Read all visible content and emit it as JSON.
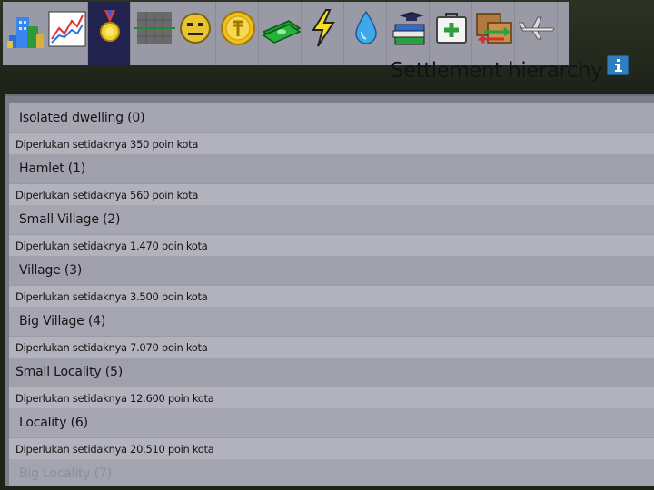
{
  "toolbar": {
    "tabs": [
      {
        "icon": "city-buildings-icon",
        "active": false
      },
      {
        "icon": "line-chart-icon",
        "active": false
      },
      {
        "icon": "medal-icon",
        "active": true
      },
      {
        "icon": "grid-map-icon",
        "active": false
      },
      {
        "icon": "smiley-face-icon",
        "active": false
      },
      {
        "icon": "gold-coin-icon",
        "active": false
      },
      {
        "icon": "money-bills-icon",
        "active": false
      },
      {
        "icon": "lightning-icon",
        "active": false
      },
      {
        "icon": "water-drop-icon",
        "active": false
      },
      {
        "icon": "books-education-icon",
        "active": false
      },
      {
        "icon": "first-aid-kit-icon",
        "active": false
      },
      {
        "icon": "trade-arrows-icon",
        "active": false
      },
      {
        "icon": "airplane-icon",
        "active": false
      }
    ]
  },
  "header": {
    "title": "Settlement hierarchy",
    "info_icon": "info-icon"
  },
  "hierarchy": [
    {
      "name": "Isolated dwelling  (0)",
      "requirement": "Diperlukan setidaknya 350 poin kota"
    },
    {
      "name": "Hamlet (1)",
      "requirement": "Diperlukan setidaknya 560 poin kota"
    },
    {
      "name": "Small Village  (2)",
      "requirement": "Diperlukan setidaknya 1.470 poin kota"
    },
    {
      "name": "Village  (3)",
      "requirement": "Diperlukan setidaknya 3.500 poin kota"
    },
    {
      "name": "Big Village  (4)",
      "requirement": "Diperlukan setidaknya 7.070 poin kota"
    },
    {
      "name": "Small Locality  (5)",
      "requirement": "Diperlukan setidaknya 12.600 poin kota"
    },
    {
      "name": "Locality  (6)",
      "requirement": "Diperlukan setidaknya 20.510 poin kota"
    },
    {
      "name": "Big Locality  (7)",
      "requirement": ""
    }
  ],
  "colors": {
    "active_tab": "#22224e",
    "toolbar": "#9a9aa6",
    "panel": "#7d7d8a",
    "info_button": "#2f7fbf"
  }
}
